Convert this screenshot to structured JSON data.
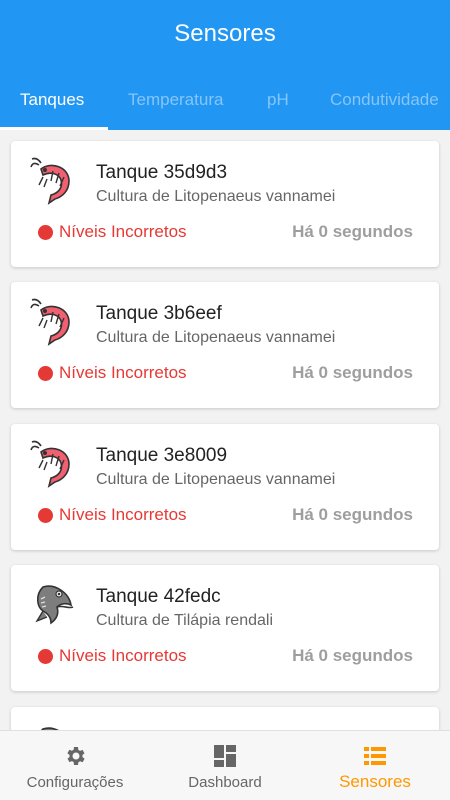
{
  "header": {
    "title": "Sensores"
  },
  "tabs": [
    {
      "label": "Tanques",
      "active": true
    },
    {
      "label": "Temperatura",
      "active": false
    },
    {
      "label": "pH",
      "active": false
    },
    {
      "label": "Condutividade",
      "active": false
    }
  ],
  "tanks": [
    {
      "name": "Tanque 35d9d3",
      "culture": "Cultura de Litopenaeus vannamei",
      "status": "Níveis Incorretos",
      "time": "Há 0 segundos",
      "icon": "shrimp-icon"
    },
    {
      "name": "Tanque 3b6eef",
      "culture": "Cultura de Litopenaeus vannamei",
      "status": "Níveis Incorretos",
      "time": "Há 0 segundos",
      "icon": "shrimp-icon"
    },
    {
      "name": "Tanque 3e8009",
      "culture": "Cultura de Litopenaeus vannamei",
      "status": "Níveis Incorretos",
      "time": "Há 0 segundos",
      "icon": "shrimp-icon"
    },
    {
      "name": "Tanque 42fedc",
      "culture": "Cultura de Tilápia rendali",
      "status": "Níveis Incorretos",
      "time": "Há 0 segundos",
      "icon": "fish-icon"
    }
  ],
  "bottom_nav": [
    {
      "label": "Configurações",
      "icon": "gear-icon",
      "active": false
    },
    {
      "label": "Dashboard",
      "icon": "dashboard-icon",
      "active": false
    },
    {
      "label": "Sensores",
      "icon": "list-icon",
      "active": true
    }
  ],
  "colors": {
    "primary": "#2196f3",
    "accent": "#ff9800",
    "error": "#e53935"
  }
}
